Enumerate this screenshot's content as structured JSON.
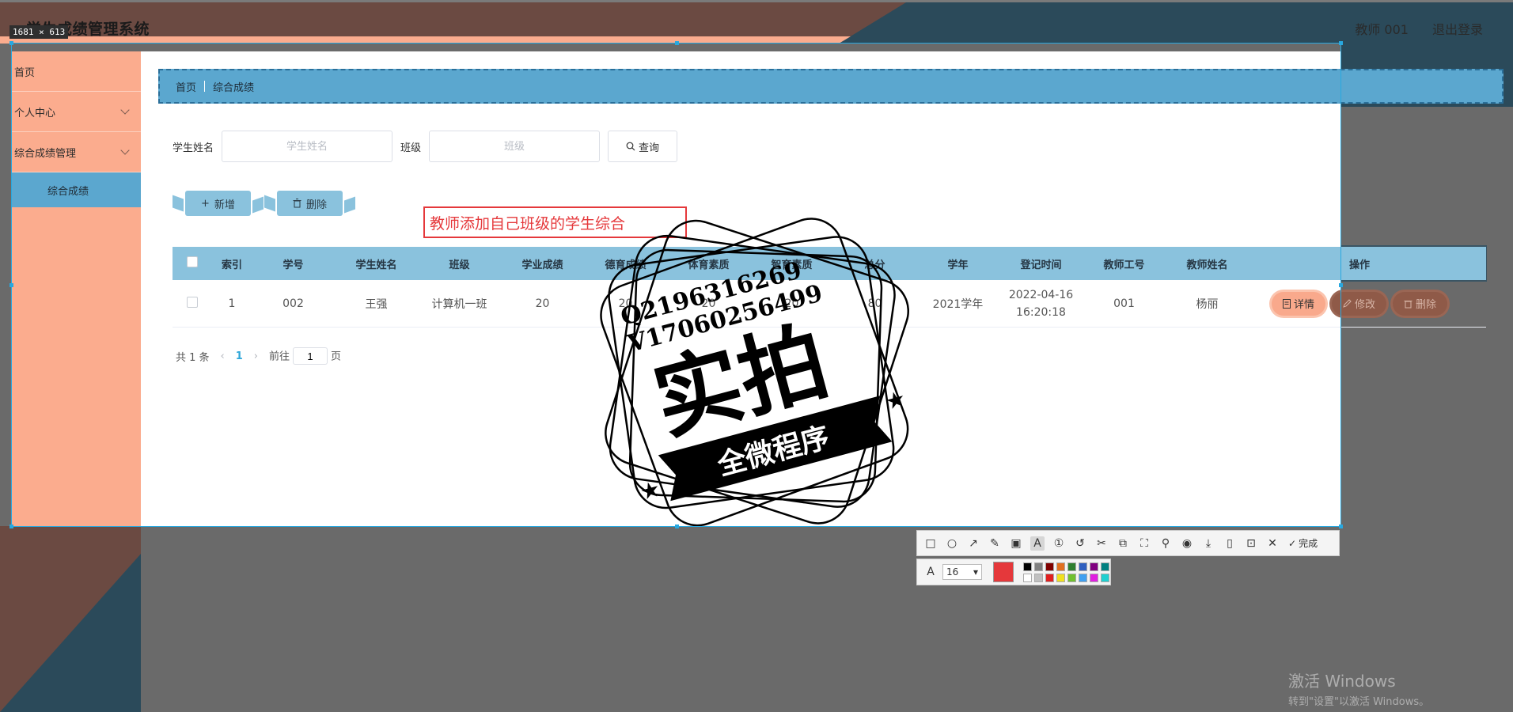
{
  "app": {
    "title": "学生成绩管理系统",
    "user": "教师 001",
    "logout": "退出登录",
    "selection_size": "1681 × 613"
  },
  "sidebar": {
    "items": [
      {
        "label": "首页"
      },
      {
        "label": "个人中心"
      },
      {
        "label": "综合成绩管理"
      },
      {
        "label": "综合成绩"
      }
    ]
  },
  "breadcrumb": {
    "home": "首页",
    "current": "综合成绩"
  },
  "search": {
    "name_label": "学生姓名",
    "name_placeholder": "学生姓名",
    "class_label": "班级",
    "class_placeholder": "班级",
    "query_label": "查询"
  },
  "actions": {
    "add_label": "新增",
    "delete_label": "删除"
  },
  "annotation": {
    "text": "教师添加自己班级的学生综合"
  },
  "table": {
    "headers": [
      "索引",
      "学号",
      "学生姓名",
      "班级",
      "学业成绩",
      "德育成绩",
      "体育素质",
      "智育素质",
      "总分",
      "学年",
      "登记时间",
      "教师工号",
      "教师姓名",
      "操作"
    ],
    "rows": [
      {
        "index": "1",
        "student_no": "002",
        "student_name": "王强",
        "class": "计算机一班",
        "academic": "20",
        "moral": "20",
        "sports": "20",
        "intel": "20",
        "total": "80",
        "year": "2021学年",
        "date": "2022-04-16",
        "time": "16:20:18",
        "teacher_no": "001",
        "teacher_name": "杨丽"
      }
    ],
    "row_actions": {
      "detail": "详情",
      "edit": "修改",
      "delete": "删除"
    }
  },
  "pager": {
    "total": "共 1 条",
    "current": "1",
    "goto_label": "前往",
    "goto_value": "1",
    "page_label": "页"
  },
  "stamp": {
    "line1": "Q2196316269",
    "line2": "V17060256499",
    "main": "实拍",
    "banner": "全微程序"
  },
  "editor": {
    "done_label": "完成",
    "font_size": "16"
  },
  "windows": {
    "activate": "激活 Windows",
    "hint": "转到\"设置\"以激活 Windows。"
  },
  "colors": {
    "accent_blue": "#5ba7cf",
    "sidebar_peach": "#fbac8e",
    "annotation_red": "#e5383b",
    "header_brown": "#6b4a42",
    "header_teal": "#2b4a5a"
  },
  "swatches": [
    "#000000",
    "#808080",
    "#800000",
    "#e07020",
    "#2f7f2f",
    "#3060c0",
    "#800080",
    "#008080",
    "#ffffff",
    "#c0c0c0",
    "#e02020",
    "#f0e020",
    "#70c030",
    "#40a0f0",
    "#e020e0",
    "#20d0d0"
  ]
}
